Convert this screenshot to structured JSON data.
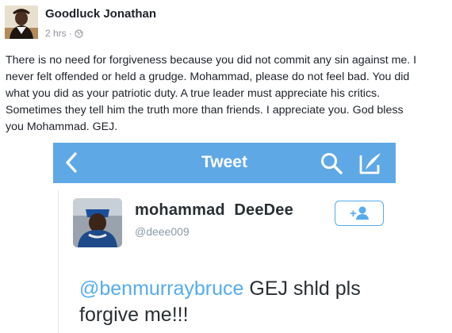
{
  "post": {
    "author": "Goodluck Jonathan",
    "time": "2 hrs",
    "separator": "·",
    "audience_icon": "globe-icon",
    "lines": [
      "There is no need for forgiveness because you did not commit any sin against me. I",
      "never felt offended or held a grudge. Mohammad, please do not feel bad. You did",
      "what you did as your patriotic duty. A true leader must appreciate his critics.",
      "Sometimes they tell him the truth more than friends. I appreciate you. God bless",
      "you Mohammad. GEJ."
    ]
  },
  "tweet_screenshot": {
    "bar_title": "Tweet",
    "bar_color": "#5fa8e6",
    "user_name": "mohammad  DeeDee",
    "user_handle": "@deee009",
    "follow_icon": "add-user-icon",
    "follow_label": "+",
    "mention": "@benmurraybruce",
    "text_after_mention": " GEJ shld pls",
    "text_line2": "forgive me!!!"
  }
}
